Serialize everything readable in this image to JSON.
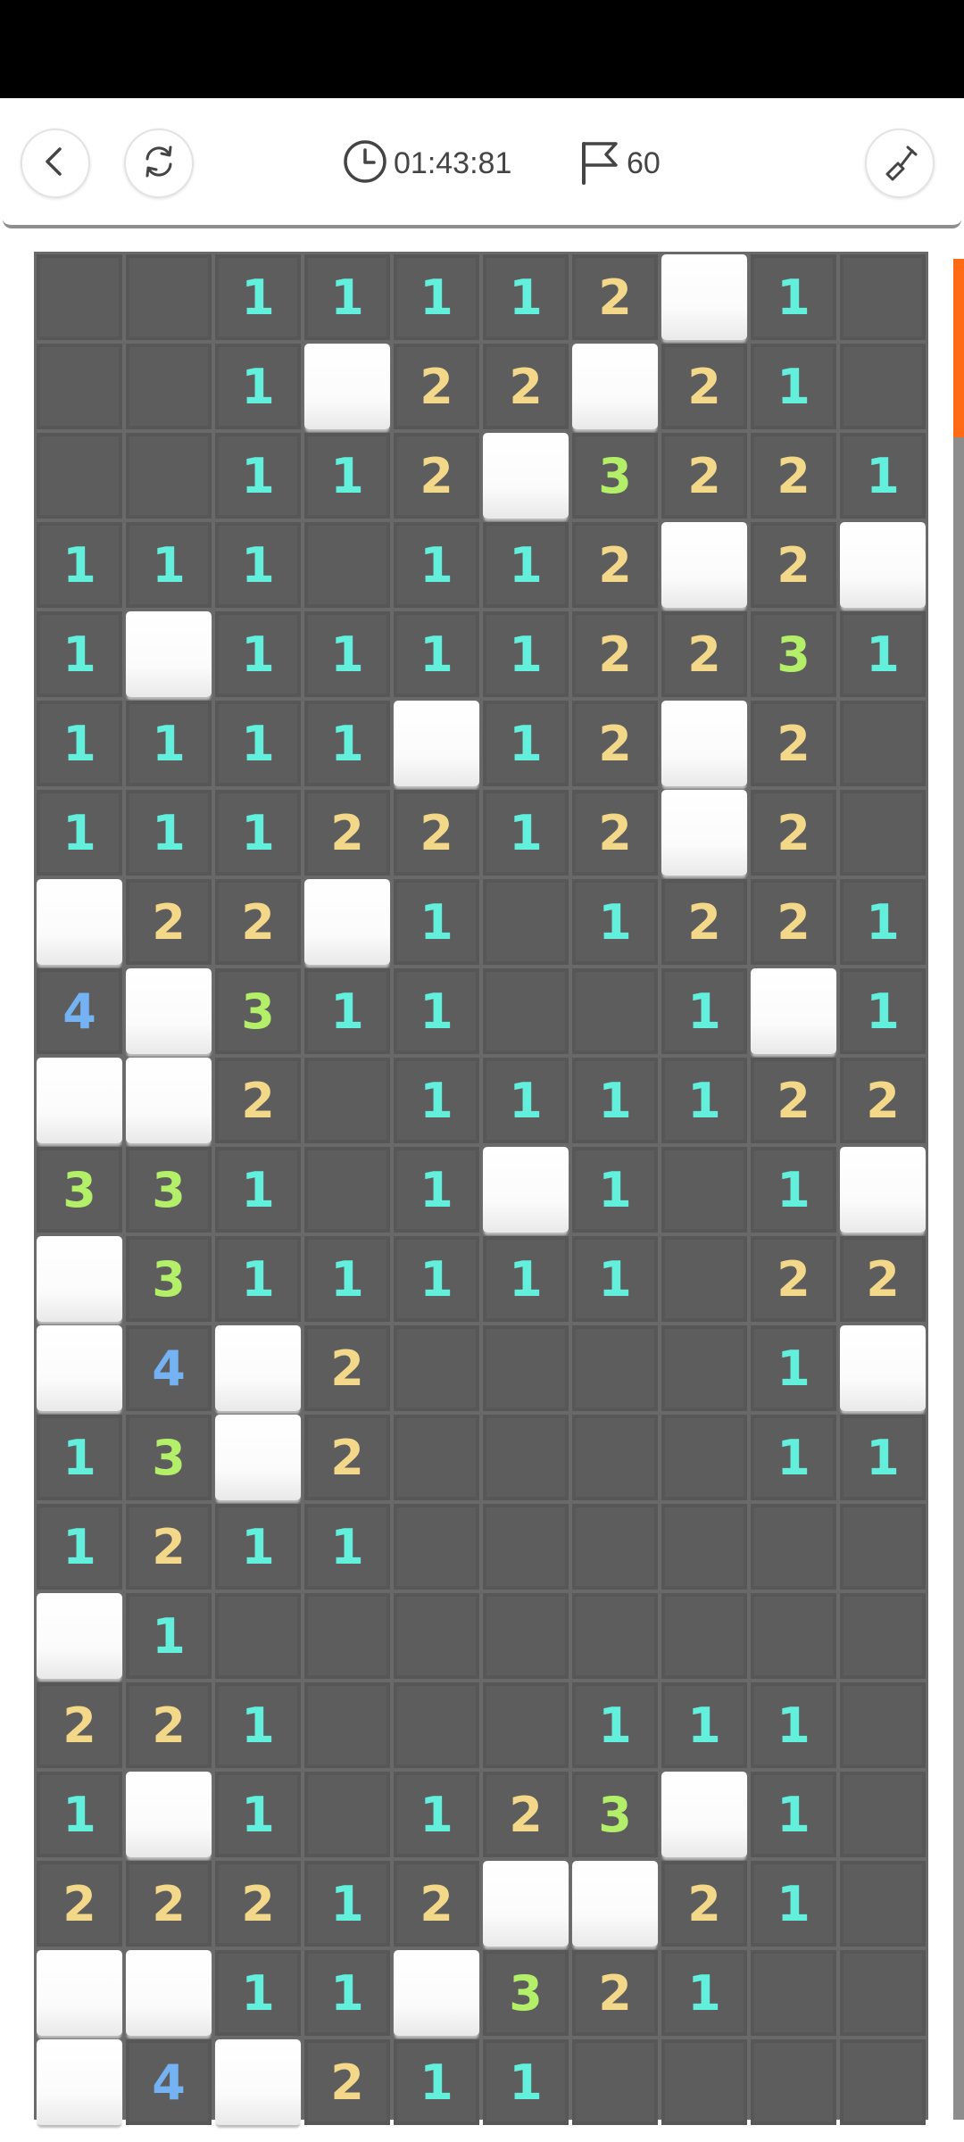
{
  "toolbar": {
    "timer": "01:43:81",
    "flags_left": "60",
    "icons": [
      "back-arrow-icon",
      "restart-icon",
      "clock-icon",
      "flag-icon",
      "shovel-icon"
    ]
  },
  "board": {
    "columns": 10,
    "rows": 21,
    "legend": {
      "H": "unrevealed",
      "": "revealed empty",
      "1-4": "adjacent mine count"
    },
    "grid": [
      [
        "",
        "",
        "1",
        "1",
        "1",
        "1",
        "2",
        "H",
        "1",
        ""
      ],
      [
        "",
        "",
        "1",
        "H",
        "2",
        "2",
        "H",
        "2",
        "1",
        ""
      ],
      [
        "",
        "",
        "1",
        "1",
        "2",
        "H",
        "3",
        "2",
        "2",
        "1"
      ],
      [
        "1",
        "1",
        "1",
        "",
        "1",
        "1",
        "2",
        "H",
        "2",
        "H"
      ],
      [
        "1",
        "H",
        "1",
        "1",
        "1",
        "1",
        "2",
        "2",
        "3",
        "1"
      ],
      [
        "1",
        "1",
        "1",
        "1",
        "H",
        "1",
        "2",
        "H",
        "2",
        ""
      ],
      [
        "1",
        "1",
        "1",
        "2",
        "2",
        "1",
        "2",
        "H",
        "2",
        ""
      ],
      [
        "H",
        "2",
        "2",
        "H",
        "1",
        "",
        "1",
        "2",
        "2",
        "1"
      ],
      [
        "4",
        "H",
        "3",
        "1",
        "1",
        "",
        "",
        "1",
        "H",
        "1"
      ],
      [
        "H",
        "H",
        "2",
        "",
        "1",
        "1",
        "1",
        "1",
        "2",
        "2"
      ],
      [
        "3",
        "3",
        "1",
        "",
        "1",
        "H",
        "1",
        "",
        "1",
        "H"
      ],
      [
        "H",
        "3",
        "1",
        "1",
        "1",
        "1",
        "1",
        "",
        "2",
        "2"
      ],
      [
        "H",
        "4",
        "H",
        "2",
        "",
        "",
        "",
        "",
        "1",
        "H"
      ],
      [
        "1",
        "3",
        "H",
        "2",
        "",
        "",
        "",
        "",
        "1",
        "1"
      ],
      [
        "1",
        "2",
        "1",
        "1",
        "",
        "",
        "",
        "",
        "",
        ""
      ],
      [
        "H",
        "1",
        "",
        "",
        "",
        "",
        "",
        "",
        "",
        ""
      ],
      [
        "2",
        "2",
        "1",
        "",
        "",
        "",
        "1",
        "1",
        "1",
        ""
      ],
      [
        "1",
        "H",
        "1",
        "",
        "1",
        "2",
        "3",
        "H",
        "1",
        ""
      ],
      [
        "2",
        "2",
        "2",
        "1",
        "2",
        "H",
        "H",
        "2",
        "1",
        ""
      ],
      [
        "H",
        "H",
        "1",
        "1",
        "H",
        "3",
        "2",
        "1",
        "",
        ""
      ],
      [
        "H",
        "4",
        "H",
        "2",
        "1",
        "1",
        "",
        "",
        "",
        ""
      ]
    ]
  },
  "colors": {
    "n1": "#62f0dc",
    "n2": "#f3d88a",
    "n3": "#b3ef69",
    "n4": "#74b2f3",
    "revealed_cell": "#5d5d5d",
    "board_gap": "#696969",
    "hidden_cell": "#ffffff",
    "scroll_thumb": "#ff6a14"
  }
}
